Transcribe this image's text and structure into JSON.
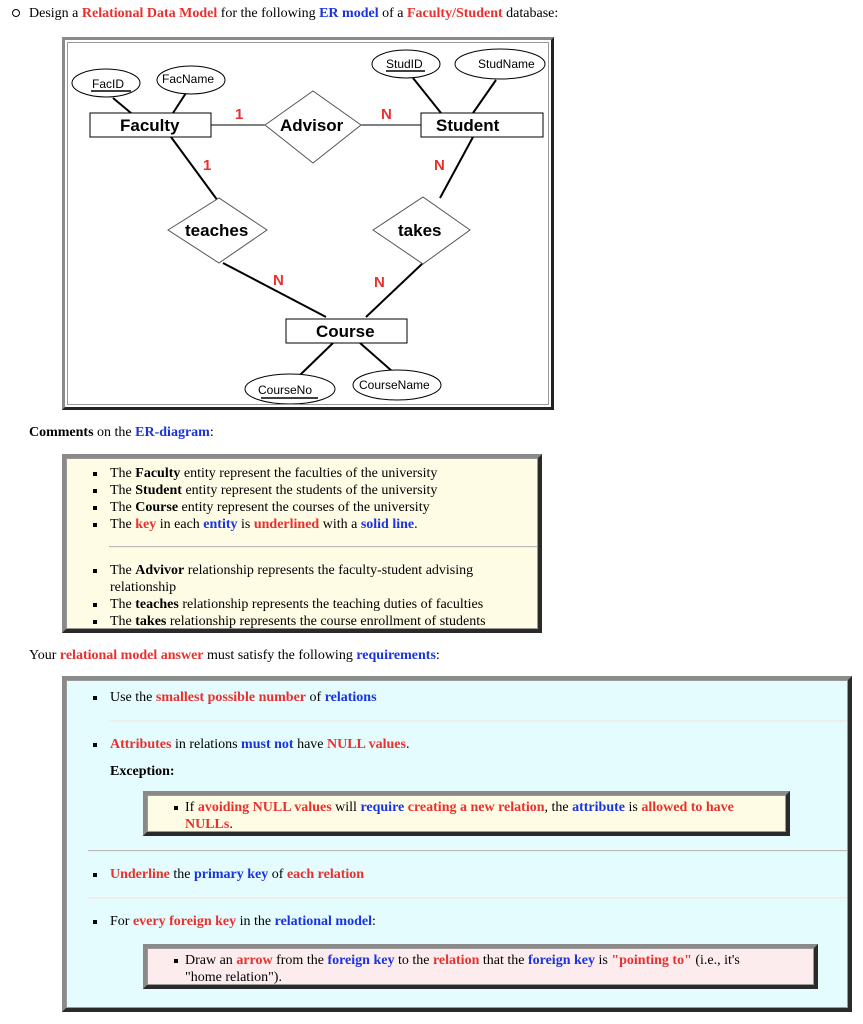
{
  "intro": {
    "parts": [
      "Design a ",
      "Relational Data Model",
      " for the following ",
      "ER model",
      " of a ",
      "Faculty/Student",
      " database:"
    ]
  },
  "er_diagram": {
    "entities": [
      {
        "name": "Faculty"
      },
      {
        "name": "Student"
      },
      {
        "name": "Course"
      }
    ],
    "relationships": [
      {
        "name": "Advisor",
        "between": [
          "Faculty",
          "Student"
        ],
        "cardinality": [
          "1",
          "N"
        ]
      },
      {
        "name": "teaches",
        "between": [
          "Faculty",
          "Course"
        ],
        "cardinality": [
          "1",
          "N"
        ]
      },
      {
        "name": "takes",
        "between": [
          "Student",
          "Course"
        ],
        "cardinality": [
          "N",
          "N"
        ]
      }
    ],
    "attributes": [
      {
        "name": "FacID",
        "entity": "Faculty",
        "key": true
      },
      {
        "name": "FacName",
        "entity": "Faculty",
        "key": false
      },
      {
        "name": "StudID",
        "entity": "Student",
        "key": true
      },
      {
        "name": "StudName",
        "entity": "Student",
        "key": false
      },
      {
        "name": "CourseNo",
        "entity": "Course",
        "key": true
      },
      {
        "name": "CourseName",
        "entity": "Course",
        "key": false
      }
    ],
    "labels": {
      "faculty": "Faculty",
      "student": "Student",
      "course": "Course",
      "advisor": "Advisor",
      "teaches": "teaches",
      "takes": "takes",
      "facid": "FacID",
      "facname": "FacName",
      "studid": "StudID",
      "studname": "StudName",
      "courseno": "CourseNo",
      "coursename": "CourseName",
      "card_fac_adv": "1",
      "card_adv_stu": "N",
      "card_fac_teach": "1",
      "card_stu_takes": "N",
      "card_teach_course": "N",
      "card_takes_course": "N"
    }
  },
  "comments": {
    "heading": [
      "Comments",
      " on the ",
      "ER-diagram",
      ":"
    ],
    "entity_items": [
      [
        "The ",
        "Faculty",
        " entity represent the faculties of the university"
      ],
      [
        "The ",
        "Student",
        " entity represent the students of the university"
      ],
      [
        "The ",
        "Course",
        " entity represent the courses of the university"
      ],
      [
        "The ",
        "key",
        " in each ",
        "entity",
        " is ",
        "underlined",
        " with a ",
        "solid line",
        "."
      ]
    ],
    "relationship_items": [
      [
        "The ",
        "Advivor",
        " relationship represents the faculty-student advising relationship"
      ],
      [
        "The ",
        "teaches",
        " relationship represents the teaching duties of faculties"
      ],
      [
        "The ",
        "takes",
        " relationship represents the course enrollment of students"
      ]
    ]
  },
  "requirements": {
    "heading": [
      "Your ",
      "relational model answer",
      " must satisfy the following ",
      "requirements",
      ":"
    ],
    "req1": [
      "Use the ",
      "smallest possible number",
      " of ",
      "relations"
    ],
    "req2": [
      "Attributes",
      " in relations ",
      "must not",
      " have ",
      "NULL values",
      "."
    ],
    "exception_label": "Exception:",
    "exception": [
      "If ",
      "avoiding NULL values",
      " will ",
      "require",
      " ",
      "creating a new relation",
      ", the ",
      "attribute",
      " is ",
      "allowed to have NULLs",
      "."
    ],
    "req3": [
      "Underline",
      " the ",
      "primary key",
      " of ",
      "each relation"
    ],
    "req4": [
      "For ",
      "every foreign key",
      " in the ",
      "relational model",
      ":"
    ],
    "arrow_rule": [
      "Draw an ",
      "arrow",
      " from the ",
      "foreign key",
      " to the ",
      "relation",
      " that the ",
      "foreign key",
      " is ",
      "\"pointing to\"",
      " (i.e., it's \"home relation\")."
    ]
  },
  "colors": {
    "red": "#e8312f",
    "blue": "#1a33e0",
    "yellow_bg": "#fffce6",
    "cyan_bg": "#e4fcfd",
    "pink_bg": "#fcecee"
  }
}
